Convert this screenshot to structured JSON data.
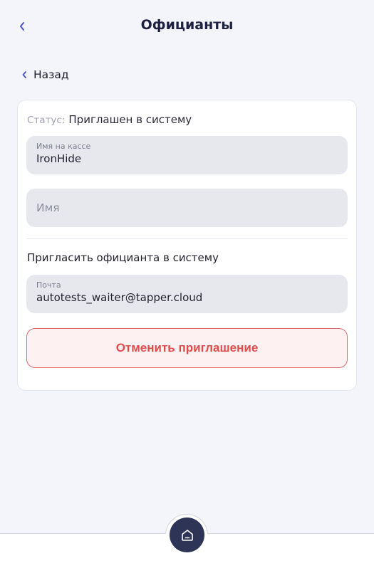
{
  "header": {
    "title": "Официанты"
  },
  "back_link": {
    "label": "Назад"
  },
  "card": {
    "status_label": "Статус:",
    "status_value": "Приглашен в систему",
    "cashier_name": {
      "label": "Имя на кассе",
      "value": "IronHide"
    },
    "name": {
      "placeholder": "Имя",
      "value": ""
    },
    "invite_title": "Пригласить официанта в систему",
    "email": {
      "label": "Почта",
      "value": "autotests_waiter@tapper.cloud"
    },
    "cancel_button_label": "Отменить приглашение"
  },
  "icons": {
    "header_back": "chevron-left-icon",
    "back_link": "chevron-left-icon",
    "home": "home-icon"
  },
  "colors": {
    "accent": "#4b56c8",
    "danger": "#e04b4b",
    "danger_bg": "#fdf1f1",
    "home_button": "#2d3456",
    "background": "#f4f5fa"
  }
}
